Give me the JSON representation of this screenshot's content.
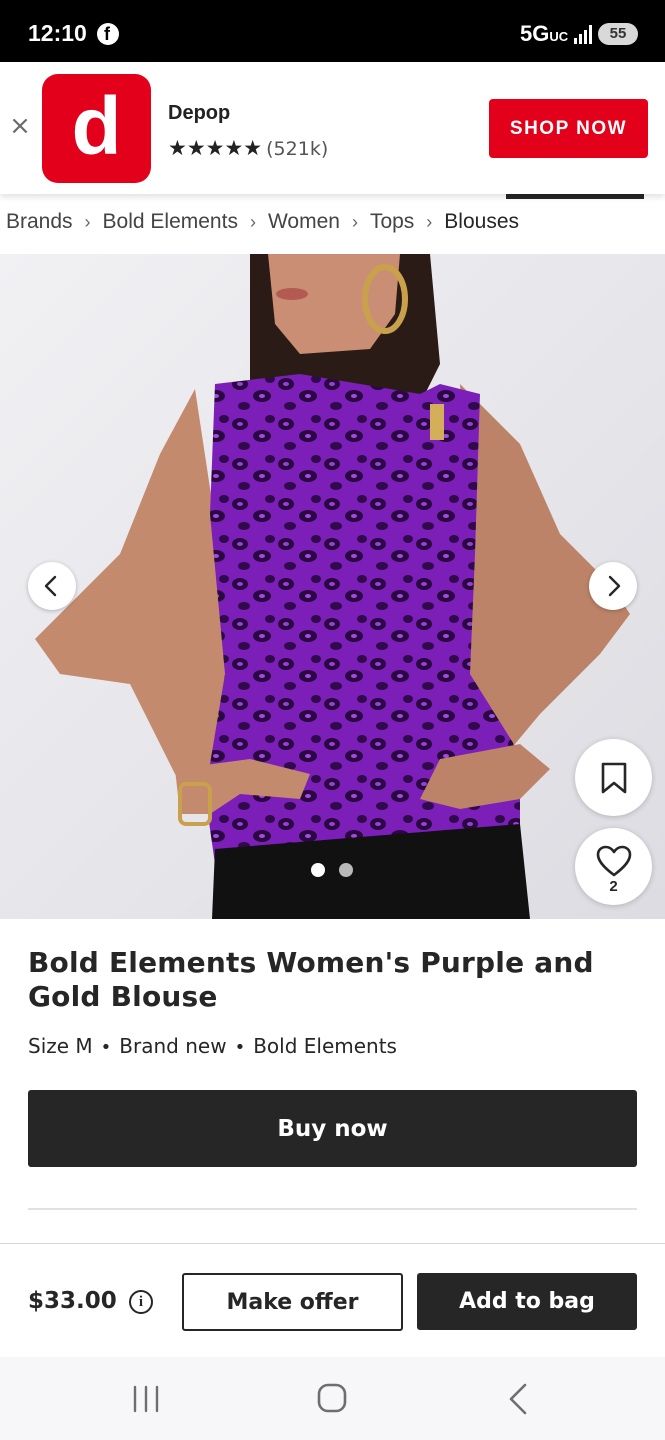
{
  "status_bar": {
    "time": "12:10",
    "network": "5G",
    "network_suffix": "UC",
    "battery": "55"
  },
  "ad": {
    "logo_letter": "d",
    "app_name": "Depop",
    "stars": "★★★★★",
    "rating_count": "(521k)",
    "cta": "SHOP NOW",
    "brand_color": "#e3001b"
  },
  "breadcrumb": {
    "items": [
      "Brands",
      "Bold Elements",
      "Women",
      "Tops",
      "Blouses"
    ],
    "separator": "›"
  },
  "gallery": {
    "active_index": 0,
    "total_images": 2,
    "likes": "2"
  },
  "product": {
    "title": "Bold Elements Women's Purple and Gold Blouse",
    "size": "Size M",
    "condition": "Brand new",
    "brand": "Bold Elements",
    "attr_separator": "•",
    "buy_now": "Buy now"
  },
  "purchase_bar": {
    "price": "$33.00",
    "info_glyph": "i",
    "make_offer": "Make offer",
    "add_to_bag": "Add to bag"
  }
}
